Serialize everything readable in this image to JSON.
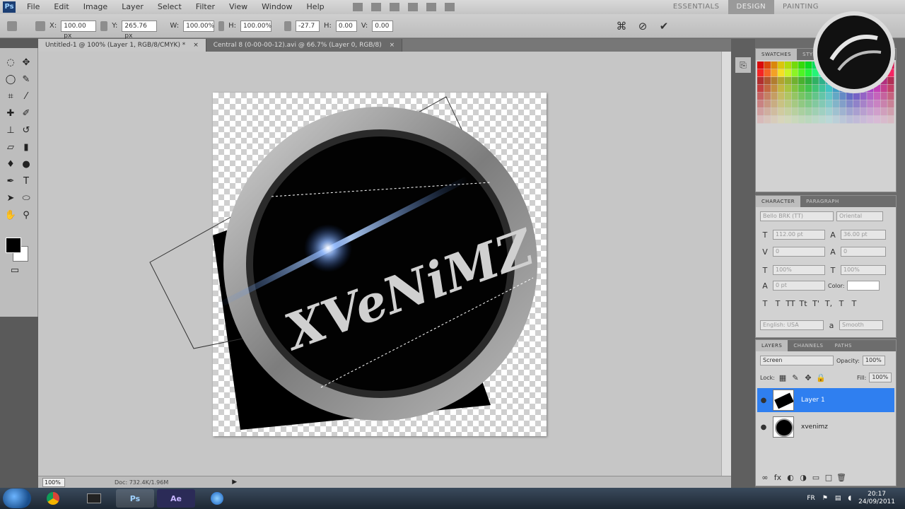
{
  "app": {
    "logo_text": "Ps",
    "menu": [
      "File",
      "Edit",
      "Image",
      "Layer",
      "Select",
      "Filter",
      "View",
      "Window",
      "Help"
    ],
    "workspaces": [
      "ESSENTIALS",
      "DESIGN",
      "PAINTING"
    ],
    "active_workspace": "DESIGN"
  },
  "options_bar": {
    "x_label": "X:",
    "x_value": "100.00 px",
    "y_label": "Y:",
    "y_value": "265.76 px",
    "w_label": "W:",
    "w_value": "100.00%",
    "h_label": "H:",
    "h_value": "100.00%",
    "angle_value": "-27.7",
    "hskew_label": "H:",
    "hskew_value": "0.00",
    "vskew_label": "V:",
    "vskew_value": "0.00",
    "warp_icon": "warp-icon",
    "cancel_icon": "cancel-icon",
    "commit_icon": "commit-checkmark-icon"
  },
  "doc_tabs": [
    {
      "label": "Untitled-1 @ 100% (Layer 1, RGB/8/CMYK) *",
      "close": "×"
    },
    {
      "label": "Central 8 (0-00-00-12).avi @ 66.7% (Layer 0, RGB/8)",
      "close": "×"
    }
  ],
  "canvas": {
    "artwork_text": "XVeNiMZ"
  },
  "status": {
    "zoom": "100%",
    "doc_info": "Doc: 732.4K/1.96M",
    "arrow": "▶"
  },
  "panels": {
    "swatches_tabs": [
      "SWATCHES",
      "STYLES"
    ],
    "character_tabs": [
      "CHARACTER",
      "PARAGRAPH"
    ],
    "font_family": "Bello BRK (TT)",
    "font_style": "Oriental",
    "font_size": "112.00 pt",
    "leading": "36.00 pt",
    "kerning": "0",
    "tracking": "0",
    "vscale": "100%",
    "hscale": "100%",
    "baseline": "0 pt",
    "color_label": "Color:",
    "language": "English: USA",
    "aa": "Smooth",
    "layers_tabs": [
      "LAYERS",
      "CHANNELS",
      "PATHS"
    ],
    "blend_mode": "Screen",
    "opacity_label": "Opacity:",
    "opacity_value": "100%",
    "lock_label": "Lock:",
    "fill_label": "Fill:",
    "fill_value": "100%",
    "layers": [
      {
        "name": "Layer 1",
        "selected": true
      },
      {
        "name": "xvenimz",
        "selected": false
      }
    ]
  },
  "taskbar": {
    "ps_label": "Ps",
    "ae_label": "Ae",
    "tray_lang": "FR",
    "time": "20:17",
    "date": "24/09/2011"
  },
  "colors": {
    "selection_blue": "#2f7ff0",
    "lens_flare": "#4a7fd8",
    "ring_metal": "#9a9a9a"
  }
}
